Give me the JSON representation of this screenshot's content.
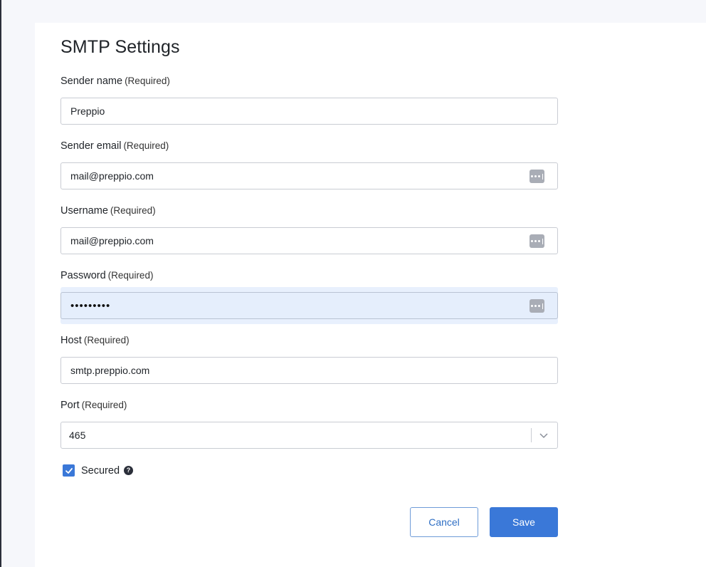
{
  "page": {
    "title": "SMTP Settings"
  },
  "required_text": "(Required)",
  "fields": {
    "sender_name": {
      "label": "Sender name",
      "value": "Preppio"
    },
    "sender_email": {
      "label": "Sender email",
      "value": "mail@preppio.com"
    },
    "username": {
      "label": "Username",
      "value": "mail@preppio.com"
    },
    "password": {
      "label": "Password",
      "value": "•••••••••"
    },
    "host": {
      "label": "Host",
      "value": "smtp.preppio.com"
    },
    "port": {
      "label": "Port",
      "value": "465"
    }
  },
  "secured": {
    "label": "Secured",
    "checked": true,
    "help_icon": "?"
  },
  "actions": {
    "cancel_label": "Cancel",
    "save_label": "Save"
  },
  "icons": {
    "autofill": "password-manager-key-icon",
    "dropdown": "chevron-down-icon",
    "check": "checkmark-icon",
    "help": "question-circle-icon"
  },
  "colors": {
    "accent": "#3a78d8",
    "focused_field_bg": "#e5eefc",
    "panel_bg": "#ffffff",
    "page_bg": "#f6f7fb"
  }
}
